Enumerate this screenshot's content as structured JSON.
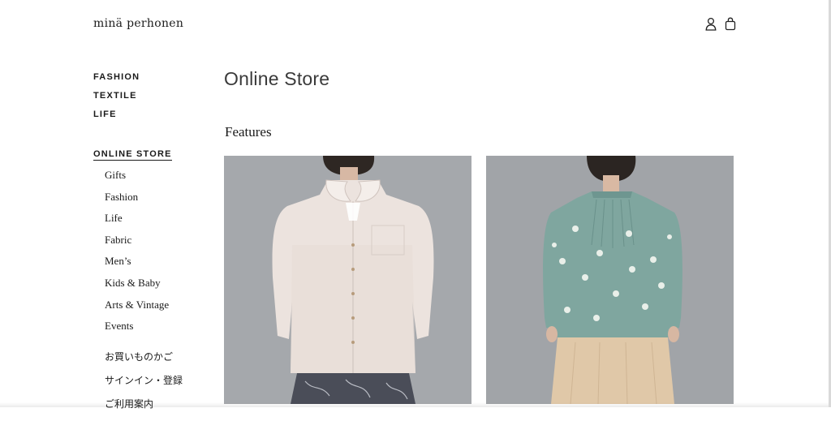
{
  "header": {
    "logo": "minä perhonen",
    "icons": [
      "account-icon",
      "bag-icon"
    ]
  },
  "sidebar": {
    "primary": [
      {
        "label": "FASHION"
      },
      {
        "label": "TEXTILE"
      },
      {
        "label": "LIFE"
      }
    ],
    "online_store": {
      "label": "ONLINE STORE",
      "items": [
        {
          "label": "Gifts"
        },
        {
          "label": "Fashion"
        },
        {
          "label": "Life"
        },
        {
          "label": "Fabric"
        },
        {
          "label": "Men’s"
        },
        {
          "label": "Kids & Baby"
        },
        {
          "label": "Arts & Vintage"
        },
        {
          "label": "Events"
        }
      ],
      "jp_items": [
        {
          "label": "お買いものかご"
        },
        {
          "label": "サインイン・登録"
        },
        {
          "label": "ご利用案内"
        }
      ]
    }
  },
  "main": {
    "title": "Online Store",
    "section_title": "Features",
    "features": [
      {
        "image": "white-blouse-photo"
      },
      {
        "image": "teal-dotted-blouse-photo"
      }
    ]
  },
  "colors": {
    "photo_background": "#9b9ea3",
    "text": "#1a1a1a"
  }
}
